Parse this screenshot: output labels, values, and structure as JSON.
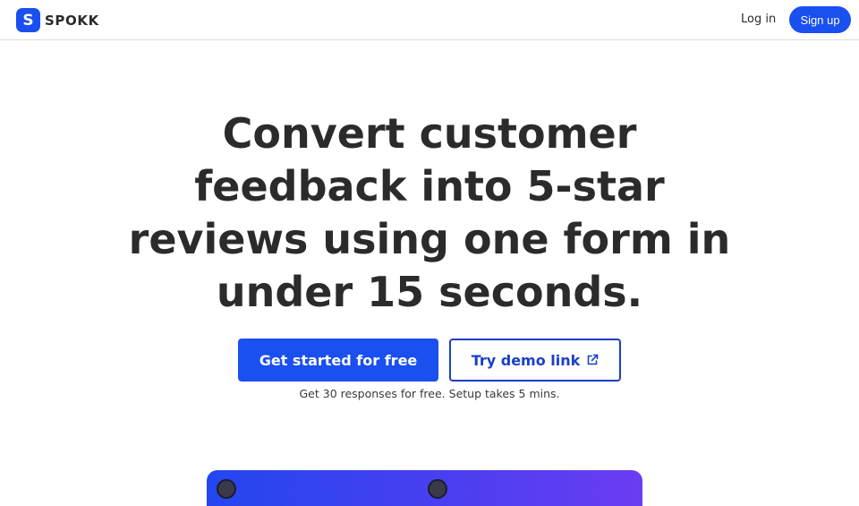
{
  "nav": {
    "brand_letter": "S",
    "brand_name": "SPOKK",
    "login": "Log in",
    "signup": "Sign up"
  },
  "hero": {
    "title": "Convert customer feedback into 5-star reviews using one form in under 15 seconds.",
    "primary_cta": "Get started for free",
    "secondary_cta": "Try demo link",
    "note": "Get 30 responses for free. Setup takes 5 mins."
  },
  "colors": {
    "accent": "#1a4ff0",
    "secondary_border": "#1a40c8",
    "text": "#2b2b2b"
  },
  "icons": {
    "brand": "s-logo-icon",
    "external": "external-link-icon"
  }
}
